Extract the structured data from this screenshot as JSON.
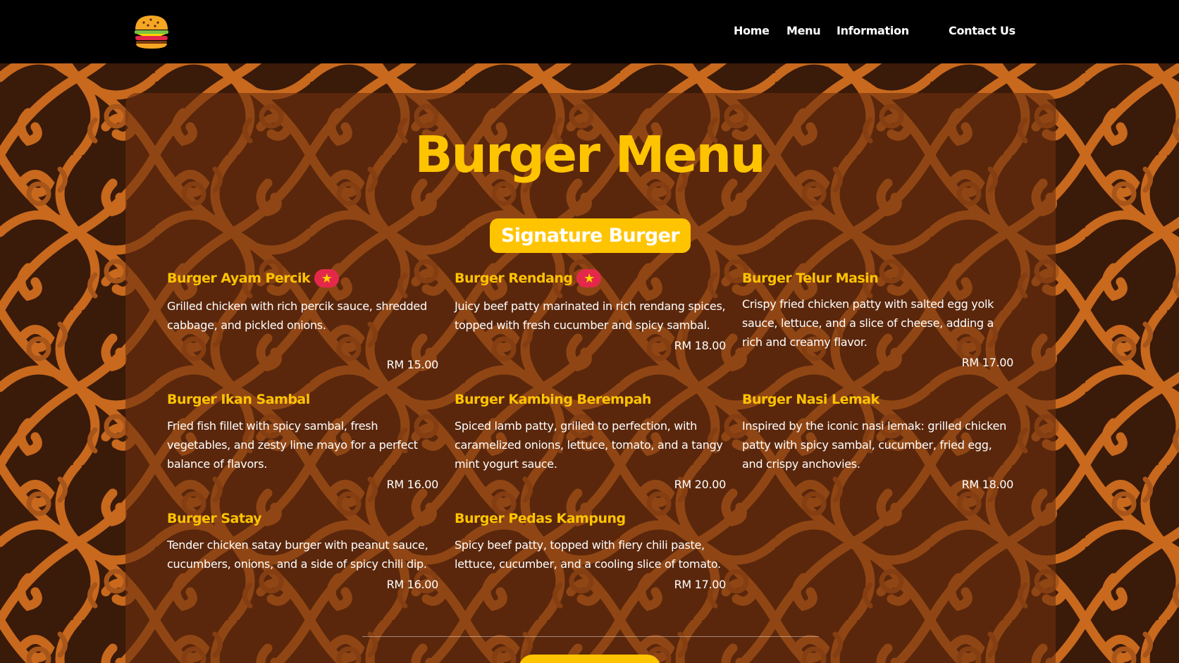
{
  "nav": {
    "logo_icon": "burger-icon",
    "links": [
      "Home",
      "Menu",
      "Information",
      "Contact Us"
    ]
  },
  "page": {
    "title": "Burger Menu",
    "section_label": "Signature Burger"
  },
  "badge_icon": "star-icon",
  "items": [
    {
      "name": "Burger Ayam Percik",
      "featured": true,
      "description": "Grilled chicken with rich percik sauce, shredded cabbage, and pickled onions.",
      "price": "RM 15.00"
    },
    {
      "name": "Burger Rendang",
      "featured": true,
      "description": "Juicy beef patty marinated in rich rendang spices, topped with fresh cucumber and spicy sambal.",
      "price": "RM 18.00"
    },
    {
      "name": "Burger Telur Masin",
      "featured": false,
      "description": "Crispy fried chicken patty with salted egg yolk sauce, lettuce, and a slice of cheese, adding a rich and creamy flavor.",
      "price": "RM 17.00"
    },
    {
      "name": "Burger Ikan Sambal",
      "featured": false,
      "description": "Fried fish fillet with spicy sambal, fresh vegetables, and zesty lime mayo for a perfect balance of flavors.",
      "price": "RM 16.00"
    },
    {
      "name": "Burger Kambing Berempah",
      "featured": false,
      "description": "Spiced lamb patty, grilled to perfection, with caramelized onions, lettuce, tomato, and a tangy mint yogurt sauce.",
      "price": "RM 20.00"
    },
    {
      "name": "Burger Nasi Lemak",
      "featured": false,
      "description": "Inspired by the iconic nasi lemak: grilled chicken patty with spicy sambal, cucumber, fried egg, and crispy anchovies.",
      "price": "RM 18.00"
    },
    {
      "name": "Burger Satay",
      "featured": false,
      "description": "Tender chicken satay burger with peanut sauce, cucumbers, onions, and a side of spicy chili dip.",
      "price": "RM 16.00"
    },
    {
      "name": "Burger Pedas Kampung",
      "featured": false,
      "description": "Spicy beef patty, topped with fiery chili paste, lettuce, cucumber, and a cooling slice of tomato.",
      "price": "RM 17.00"
    }
  ],
  "colors": {
    "accent": "#ffc400",
    "badge": "#e4284a",
    "nav_bg": "#000000",
    "pattern_dark": "#3a1a08",
    "pattern_light": "#c8691e"
  }
}
